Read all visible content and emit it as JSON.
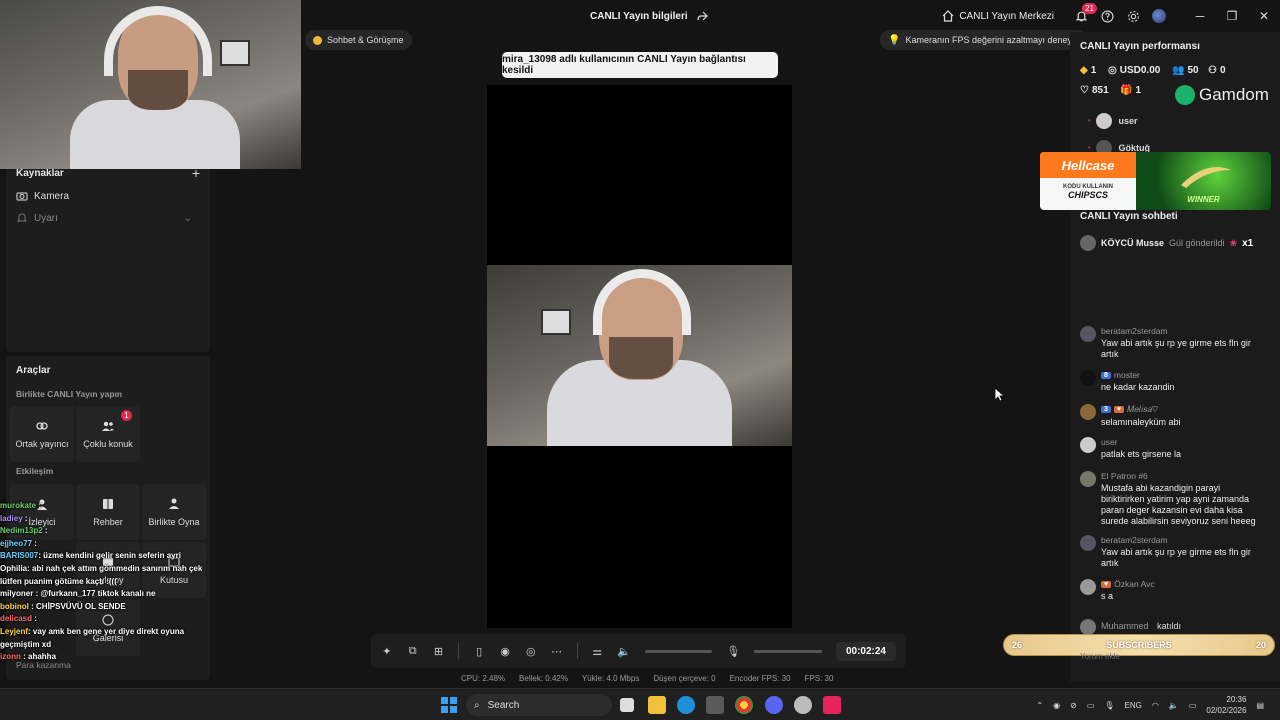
{
  "app": {
    "title": "CANLI Yayın bilgileri",
    "center_link": "CANLI Yayın Merkezi",
    "notif_count": "21"
  },
  "window_controls": {
    "minimize": "─",
    "maximize": "❐",
    "close": "✕"
  },
  "sidebar": {
    "sources_title": "Kaynaklar",
    "sources": [
      {
        "label": "Kamera",
        "icon": "camera-icon"
      },
      {
        "label": "Uyarı",
        "icon": "bell-icon"
      }
    ],
    "tools_title": "Araçlar",
    "collab_title": "Birlikte CANLI Yayın yapın",
    "collab_tiles": [
      {
        "label": "Ortak yayıncı",
        "icon": "link-icon"
      },
      {
        "label": "Çoklu konuk",
        "icon": "multi-user-icon",
        "badge": "1"
      }
    ],
    "interaction_title": "Etkileşim",
    "interaction_tiles": [
      {
        "label": "İzleyici",
        "icon": "viewer-icon"
      },
      {
        "label": "Rehber",
        "icon": "guide-icon"
      },
      {
        "label": "Birlikte Oyna",
        "icon": "play-together-icon"
      }
    ],
    "more_tiles": [
      {
        "label": "...yle oy"
      },
      {
        "label": "Kutusu"
      },
      {
        "label": "Galerisi"
      }
    ],
    "footer_item": "Para kazanma"
  },
  "overlay_chat": [
    {
      "name": "murokate",
      "text": ":"
    },
    {
      "name": "ladiey",
      "text": ":"
    },
    {
      "name": "Nedim13p2",
      "text": ":"
    },
    {
      "name": "ejjheo77",
      "text": ":"
    },
    {
      "name": "BARIS007",
      "text": ": üzme kendini gelir senin seferin ayri"
    },
    {
      "name": "Ophilia",
      "text": ": abi nah çek attım gömmedin sanırım nah çek lütfen puanim götüme kaçtı :((("
    },
    {
      "name": "milyoner",
      "text": ": @furkann_177 tiktok kanalı ne"
    },
    {
      "name": "bobinol",
      "text": ": CHİPSVÜVÜ OL SENDE"
    },
    {
      "name": "delicasd",
      "text": ":"
    },
    {
      "name": "Leyjenf",
      "text": ": vay amk ben gene yer diye direkt oyuna geçmiştim xd"
    },
    {
      "name": "izonn",
      "text": ": ahahha"
    }
  ],
  "center": {
    "chat_pill": "Sohbet & Görüşme",
    "fps_pill": "Kameranın FPS değerini azaltmayı deneyin",
    "toast": "mira_13098 adlı kullanıcının CANLI Yayın bağlantısı kesildi",
    "timer": "00:02:24",
    "stats": [
      "CPU: 2.48%",
      "Bellek: 0.42%",
      "Yükle: 4.0 Mbps",
      "Düşen çerçeve: 0",
      "Encoder FPS: 30",
      "FPS: 30"
    ],
    "volume_level": 0,
    "mic_level": 0
  },
  "right": {
    "perf_title": "CANLI Yayın performansı",
    "metrics": {
      "diamonds": "1",
      "usd": "USD0.00",
      "viewers": "50",
      "followers": "0",
      "likes": "851",
      "gifts": "1"
    },
    "gamdom": "Gamdom",
    "users": [
      "user",
      "Göktuğ"
    ],
    "hellcase": {
      "logo": "Hellcase",
      "line1": "KODU KULLANIN",
      "code": "CHIPSCS",
      "win": "WINNER"
    },
    "chat_title": "CANLI Yayın sohbeti",
    "gift": {
      "user": "KÖYCÜ Musse",
      "text": "Gül gönderildi",
      "count": "x1"
    },
    "messages": [
      {
        "user": "beratam2sterdam",
        "text": "Yaw abi artık şu rp ye girme ets fln gir artık"
      },
      {
        "user": "moster",
        "level": "8",
        "text": "ne kadar kazandin"
      },
      {
        "user": "𝑀𝑒𝑙𝑖𝑠𝑎♡",
        "level": "3",
        "text": "selamınaleyküm abi"
      },
      {
        "user": "user",
        "text": "patlak ets girsene la"
      },
      {
        "user": "El Patron #6",
        "text": "Mustafa abi kazandigin parayi biriktirirken yatirim yap ayni zamanda paran deger kazansin evi daha kisa surede alabilirsin seviyoruz seni heeeg"
      },
      {
        "user": "beratam2sterdam",
        "text": "Yaw abi artık şu rp ye girme ets fln gir artık"
      },
      {
        "user": "Özkan Avc",
        "text": "s a"
      },
      {
        "user": "Muhammed",
        "text": "katıldı"
      }
    ],
    "subs": {
      "left": "26",
      "label": "SUBSCRIBERS",
      "right": "20"
    },
    "comment_placeholder": "Yorum ekle"
  },
  "taskbar": {
    "search": "Search",
    "lang": "ENG",
    "time": "20:36",
    "date": "02/02/2026"
  }
}
